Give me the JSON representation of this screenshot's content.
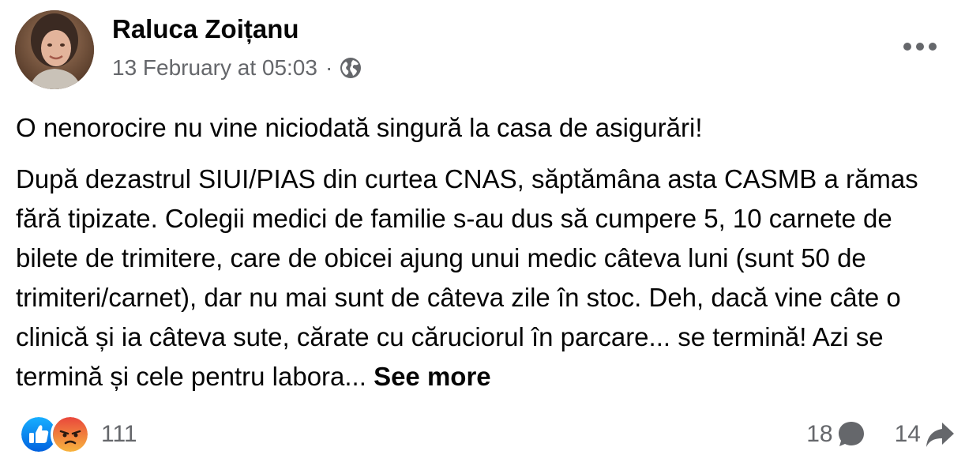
{
  "post": {
    "author_name": "Raluca Zoițanu",
    "timestamp": "13 February at 05:03",
    "separator": "·",
    "privacy_icon": "globe-icon",
    "menu_icon": "more-options-icon",
    "headline": "O nenorocire nu vine niciodată singură la casa de asigurări!",
    "body": "După dezastrul SIUI/PIAS din curtea CNAS, săptămâna asta CASMB a rămas fără tipizate. Colegii medici de familie s-au dus să cumpere 5, 10 carnete de bilete de trimitere, care de obicei ajung unui medic câteva luni (sunt 50 de trimiteri/carnet), dar nu mai sunt de câteva zile în stoc. Deh, dacă vine câte o clinică și ia câteva sute, cărate cu căruciorul în parcare... se termină! Azi se termină și cele pentru labora...",
    "see_more_label": "See more"
  },
  "reactions": {
    "icons": [
      "like-icon",
      "angry-icon"
    ],
    "count": "111"
  },
  "stats": {
    "comments": "18",
    "comment_icon": "comment-icon",
    "shares": "14",
    "share_icon": "share-icon"
  },
  "colors": {
    "text": "#050505",
    "secondary": "#65676b",
    "like_blue": "#1877f2",
    "angry_orange": "#f0672d"
  }
}
